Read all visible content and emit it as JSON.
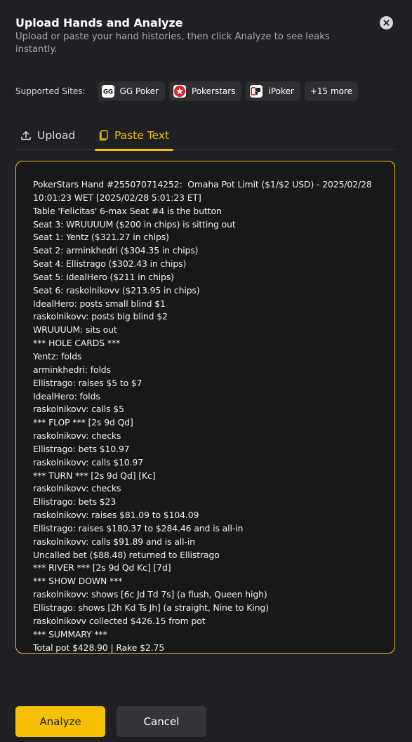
{
  "header": {
    "title": "Upload Hands and Analyze",
    "subtitle": "Upload or paste your hand histories, then click Analyze to see leaks instantly."
  },
  "sites": {
    "label": "Supported Sites:",
    "items": [
      {
        "name": "GG Poker",
        "icon": "ggpoker-logo",
        "logo_text": "GG"
      },
      {
        "name": "Pokerstars",
        "icon": "pokerstars-logo"
      },
      {
        "name": "iPoker",
        "icon": "ipoker-logo"
      }
    ],
    "more": "+15 more"
  },
  "tabs": {
    "upload": {
      "label": "Upload",
      "icon": "upload-icon"
    },
    "paste": {
      "label": "Paste Text",
      "icon": "clipboard-icon",
      "active": true
    }
  },
  "hand_history": "PokerStars Hand #255070714252:  Omaha Pot Limit ($1/$2 USD) - 2025/02/28 10:01:23 WET [2025/02/28 5:01:23 ET]\nTable 'Felicitas' 6-max Seat #4 is the button\nSeat 3: WRUUUUM ($200 in chips) is sitting out\nSeat 1: Yentz ($321.27 in chips)\nSeat 2: arminkhedri ($304.35 in chips)\nSeat 4: Ellistrago ($302.43 in chips)\nSeat 5: IdealHero ($211 in chips)\nSeat 6: raskolnikovv ($213.95 in chips)\nIdealHero: posts small blind $1\nraskolnikovv: posts big blind $2\nWRUUUUM: sits out\n*** HOLE CARDS ***\nYentz: folds\narminkhedri: folds\nEllistrago: raises $5 to $7\nIdealHero: folds\nraskolnikovv: calls $5\n*** FLOP *** [2s 9d Qd]\nraskolnikovv: checks\nEllistrago: bets $10.97\nraskolnikovv: calls $10.97\n*** TURN *** [2s 9d Qd] [Kc]\nraskolnikovv: checks\nEllistrago: bets $23\nraskolnikovv: raises $81.09 to $104.09\nEllistrago: raises $180.37 to $284.46 and is all-in\nraskolnikovv: calls $91.89 and is all-in\nUncalled bet ($88.48) returned to Ellistrago\n*** RIVER *** [2s 9d Qd Kc] [7d]\n*** SHOW DOWN ***\nraskolnikovv: shows [6c Jd Td 7s] (a flush, Queen high)\nEllistrago: shows [2h Kd Ts Jh] (a straight, Nine to King)\nraskolnikovv collected $426.15 from pot\n*** SUMMARY ***\nTotal pot $428.90 | Rake $2.75",
  "footer": {
    "analyze_label": "Analyze",
    "cancel_label": "Cancel"
  },
  "colors": {
    "accent": "#f5c000",
    "background": "#1f2023",
    "textarea_bg": "#17181a",
    "chip_bg": "#2d2f33",
    "secondary_button": "#33353a"
  }
}
